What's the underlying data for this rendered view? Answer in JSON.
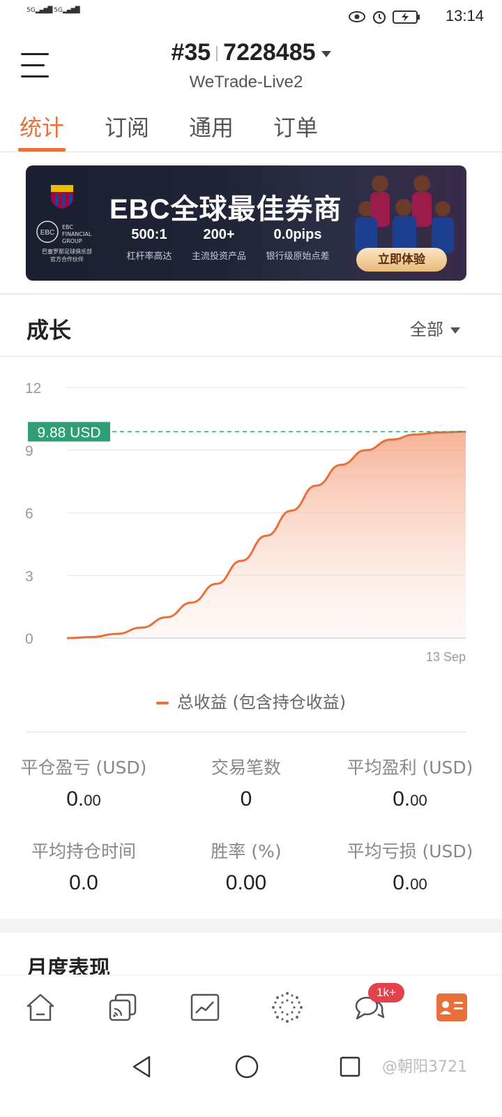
{
  "status_bar": {
    "signal_left": "5G",
    "signal_right": "5G",
    "time": "13:14"
  },
  "header": {
    "account_prefix": "#35",
    "account_number": "7228485",
    "server": "WeTrade-Live2"
  },
  "tabs": [
    {
      "label": "统计",
      "active": true
    },
    {
      "label": "订阅",
      "active": false
    },
    {
      "label": "通用",
      "active": false
    },
    {
      "label": "订单",
      "active": false
    }
  ],
  "banner": {
    "title": "EBC全球最佳券商",
    "stats": [
      {
        "value": "500:1",
        "label": "杠杆率高达"
      },
      {
        "value": "200+",
        "label": "主流投资产品"
      },
      {
        "value": "0.0pips",
        "label": "银行级原始点差"
      }
    ],
    "cta": "立即体验",
    "brand": "EBC FINANCIAL GROUP",
    "partner_line1": "巴塞罗那足球俱乐部",
    "partner_line2": "官方合作伙伴"
  },
  "growth": {
    "title": "成长",
    "filter": "全部"
  },
  "chart_data": {
    "type": "area",
    "x": [
      "",
      "13 Sep"
    ],
    "x_tick_labels": [
      "13 Sep"
    ],
    "y_ticks": [
      0,
      3,
      6,
      9,
      12
    ],
    "ylim": [
      0,
      12
    ],
    "series": [
      {
        "name": "总收益 (包含持仓收益)",
        "values": [
          0.0,
          0.05,
          0.2,
          0.5,
          1.0,
          1.7,
          2.6,
          3.7,
          4.9,
          6.1,
          7.3,
          8.3,
          9.0,
          9.5,
          9.75,
          9.85,
          9.88
        ],
        "color": "#e8703a"
      }
    ],
    "marker_label": "9.88 USD",
    "marker_value": 9.88,
    "marker_color": "#2e9e74"
  },
  "legend_label": "总收益 (包含持仓收益)",
  "stats": [
    {
      "label": "平仓盈亏 (USD)",
      "int": "0.",
      "dec": "00"
    },
    {
      "label": "交易笔数",
      "int": "0",
      "dec": ""
    },
    {
      "label": "平均盈利 (USD)",
      "int": "0.",
      "dec": "00"
    },
    {
      "label": "平均持仓时间",
      "int": "0.0",
      "dec": ""
    },
    {
      "label": "胜率 (%)",
      "int": "0.00",
      "dec": ""
    },
    {
      "label": "平均亏损 (USD)",
      "int": "0.",
      "dec": "00"
    }
  ],
  "monthly": {
    "title": "月度表现"
  },
  "bottom_nav": {
    "items": [
      "home-icon",
      "signals-icon",
      "chart-icon",
      "explore-icon",
      "chat-icon",
      "profile-icon"
    ],
    "badge": "1k+",
    "active_color": "#e8703a"
  },
  "watermark": "@朝阳3721"
}
